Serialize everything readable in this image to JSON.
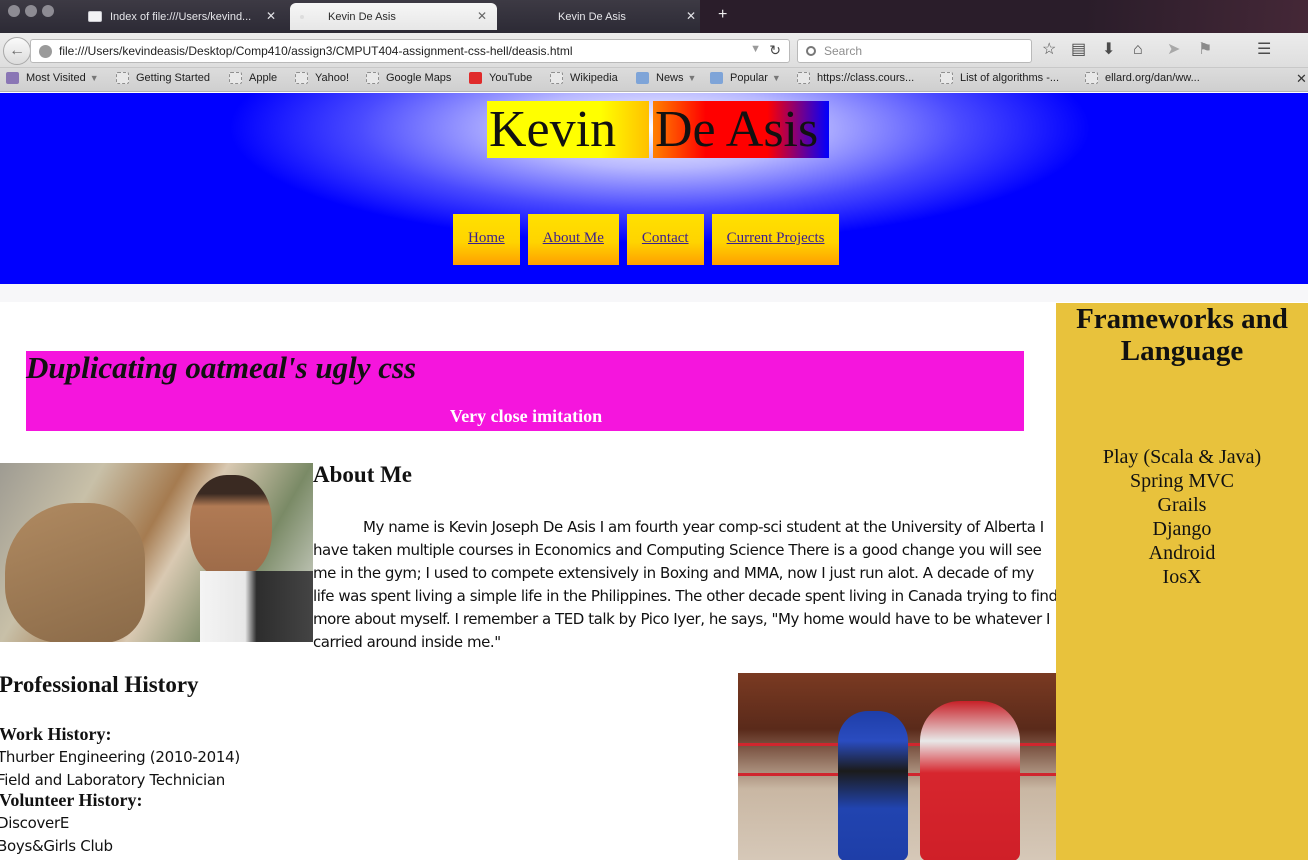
{
  "browser": {
    "tabs": [
      {
        "label": "Index of file:///Users/kevind..."
      },
      {
        "label": "Kevin De Asis"
      },
      {
        "label": "Kevin De Asis"
      }
    ],
    "url": "file:///Users/kevindeasis/Desktop/Comp410/assign3/CMPUT404-assignment-css-hell/deasis.html",
    "search_placeholder": "Search",
    "bookmarks": [
      {
        "label": "Most Visited"
      },
      {
        "label": "Getting Started"
      },
      {
        "label": "Apple"
      },
      {
        "label": "Yahoo!"
      },
      {
        "label": "Google Maps"
      },
      {
        "label": "YouTube"
      },
      {
        "label": "Wikipedia"
      },
      {
        "label": "News"
      },
      {
        "label": "Popular"
      },
      {
        "label": "https://class.cours..."
      },
      {
        "label": "List of algorithms -..."
      },
      {
        "label": "ellard.org/dan/ww..."
      }
    ]
  },
  "page": {
    "name_first": "Kevin",
    "name_last": "De Asis",
    "nav": [
      {
        "label": "Home"
      },
      {
        "label": "About Me"
      },
      {
        "label": "Contact"
      },
      {
        "label": "Current Projects"
      }
    ],
    "banner": {
      "title": "Duplicating oatmeal's ugly css",
      "subtitle": "Very close imitation"
    },
    "about": {
      "heading": "About Me",
      "body": "My name is Kevin Joseph De Asis I am fourth year comp-sci student at the University of Alberta I have taken multiple courses in Economics and Computing Science There is a good change you will see me in the gym; I used to compete extensively in Boxing and MMA, now I just run alot. A decade of my life was spent living a simple life in the Philippines. The other decade spent living in Canada trying to find more about myself. I remember a TED talk by Pico Iyer, he says, \"My home would have to be whatever I carried around inside me.\""
    },
    "professional": {
      "heading": "Professional History",
      "work_heading": "Work History:",
      "work_items": [
        "Thurber Engineering (2010-2014)",
        "Field and Laboratory Technician"
      ],
      "volunteer_heading": "Volunteer History:",
      "volunteer_items": [
        "DiscoverE",
        "Boys&Girls Club"
      ]
    },
    "sidebar": {
      "heading": "Frameworks and Language",
      "items": [
        "Play (Scala & Java)",
        "Spring MVC",
        "Grails",
        "Django",
        "Android",
        "IosX"
      ]
    }
  }
}
